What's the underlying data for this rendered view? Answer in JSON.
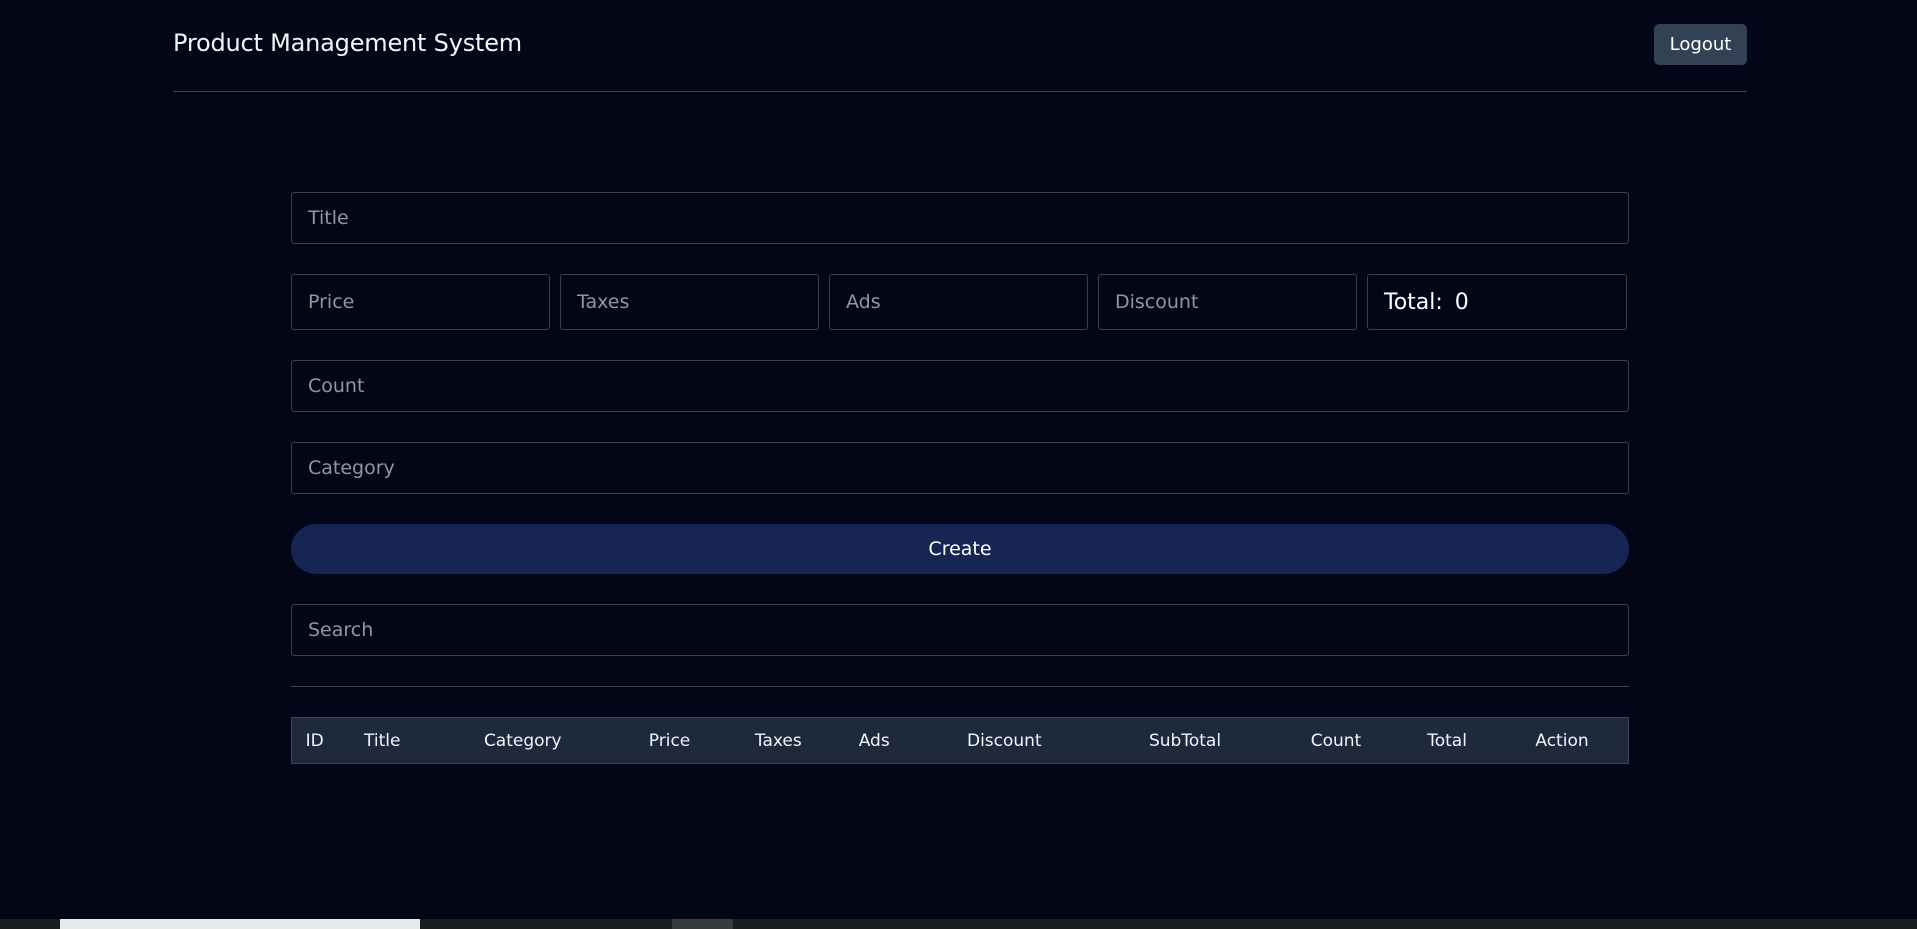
{
  "header": {
    "title": "Product Management System",
    "logout_label": "Logout"
  },
  "form": {
    "title_placeholder": "Title",
    "price_placeholder": "Price",
    "taxes_placeholder": "Taxes",
    "ads_placeholder": "Ads",
    "discount_placeholder": "Discount",
    "total_label": "Total:",
    "total_value": "0",
    "count_placeholder": "Count",
    "category_placeholder": "Category",
    "create_label": "Create",
    "search_placeholder": "Search"
  },
  "table": {
    "columns": [
      "ID",
      "Title",
      "Category",
      "Price",
      "Taxes",
      "Ads",
      "Discount",
      "SubTotal",
      "Count",
      "Total",
      "Action"
    ]
  },
  "colors": {
    "background": "#020617",
    "logout_button": "#334155",
    "create_button": "#172554",
    "table_header": "#1e293b"
  }
}
